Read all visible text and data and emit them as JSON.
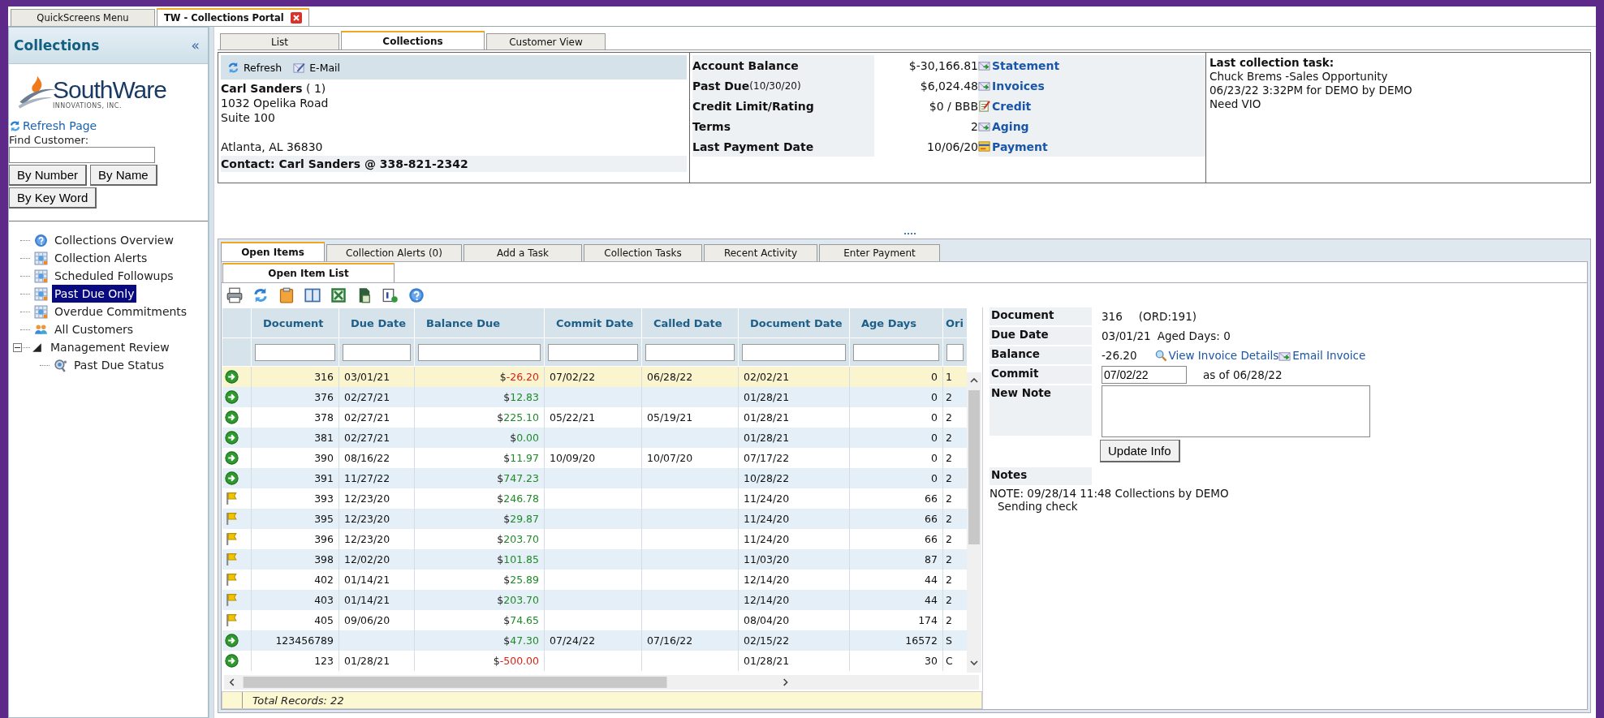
{
  "top_tabs": [
    {
      "label": "QuickScreens Menu",
      "selected": false,
      "closable": false
    },
    {
      "label": "TW - Collections Portal",
      "selected": true,
      "closable": true
    }
  ],
  "sidebar": {
    "title": "Collections",
    "collapse": "«",
    "logo": {
      "name": "SouthWare",
      "tagline": "INNOVATIONS, INC."
    },
    "refresh_link": "Refresh Page",
    "find_label": "Find Customer:",
    "buttons": [
      "By Number",
      "By Name",
      "By Key Word"
    ],
    "tree": [
      {
        "label": "Collections Overview",
        "kind": "help",
        "selected": false
      },
      {
        "label": "Collection Alerts",
        "kind": "report",
        "selected": false
      },
      {
        "label": "Scheduled Followups",
        "kind": "report",
        "selected": false
      },
      {
        "label": "Past Due Only",
        "kind": "report",
        "selected": true
      },
      {
        "label": "Overdue Commitments",
        "kind": "report",
        "selected": false
      },
      {
        "label": "All Customers",
        "kind": "people",
        "selected": false
      },
      {
        "label": "Management Review",
        "kind": "folder",
        "selected": false,
        "expanded": true,
        "children": [
          {
            "label": "Past Due Status",
            "kind": "status",
            "selected": false
          }
        ]
      }
    ]
  },
  "view_tabs": [
    {
      "label": "List",
      "selected": false
    },
    {
      "label": "Collections",
      "selected": true
    },
    {
      "label": "Customer View",
      "selected": false
    }
  ],
  "customer": {
    "toolbar": [
      {
        "label": "Refresh",
        "kind": "refresh"
      },
      {
        "label": "E-Mail",
        "kind": "email"
      }
    ],
    "name": "Carl Sanders",
    "number": "( 1)",
    "address": [
      "1032 Opelika Road",
      "Suite 100"
    ],
    "city_line": "Atlanta, AL  36830",
    "contact_label": "Contact:",
    "contact": "Carl Sanders @ 338-821-2342"
  },
  "account": [
    {
      "label": "Account Balance",
      "value": "$-30,166.81",
      "link": "Statement",
      "kind": "envelope"
    },
    {
      "label": "Past Due",
      "note": "(10/30/20)",
      "value": "$6,024.48",
      "link": "Invoices",
      "kind": "envelope"
    },
    {
      "label": "Credit Limit/Rating",
      "value": "$0 / BBB",
      "link": "Credit",
      "kind": "notepad"
    },
    {
      "label": "Terms",
      "value": "2",
      "link": "Aging",
      "kind": "envelope"
    },
    {
      "label": "Last Payment Date",
      "value": "10/06/20",
      "link": "Payment",
      "kind": "card"
    }
  ],
  "last_task": {
    "title": "Last collection task:",
    "lines": [
      "Chuck Brems -Sales Opportunity",
      "06/23/22 3:32PM for DEMO by DEMO",
      "Need VIO"
    ]
  },
  "detail_tabs": [
    {
      "label": "Open Items",
      "selected": true
    },
    {
      "label": "Collection Alerts (0)",
      "selected": false
    },
    {
      "label": "Add a Task",
      "selected": false
    },
    {
      "label": "Collection Tasks",
      "selected": false
    },
    {
      "label": "Recent Activity",
      "selected": false
    },
    {
      "label": "Enter Payment",
      "selected": false
    }
  ],
  "sub_tabs": [
    {
      "label": "Open Item List",
      "selected": true
    }
  ],
  "table": {
    "columns": [
      "Document",
      "Due Date",
      "Balance Due",
      "Commit Date",
      "Called Date",
      "Document Date",
      "Age Days",
      "Ori"
    ],
    "rows": [
      {
        "kind": "arrow",
        "selected": true,
        "document": "316",
        "due_date": "03/01/21",
        "balance": {
          "currency": "$",
          "amount": "-26.20",
          "negative": true
        },
        "commit_date": "07/02/22",
        "called_date": "06/28/22",
        "document_date": "02/02/21",
        "age_days": "0",
        "column_8": "1"
      },
      {
        "kind": "arrow",
        "selected": false,
        "document": "376",
        "due_date": "02/27/21",
        "balance": {
          "currency": "$",
          "amount": "12.83",
          "negative": false
        },
        "document_date": "01/28/21",
        "age_days": "0",
        "column_8": "2"
      },
      {
        "kind": "arrow",
        "selected": false,
        "document": "378",
        "due_date": "02/27/21",
        "balance": {
          "currency": "$",
          "amount": "225.10",
          "negative": false
        },
        "commit_date": "05/22/21",
        "called_date": "05/19/21",
        "document_date": "01/28/21",
        "age_days": "0",
        "column_8": "2"
      },
      {
        "kind": "arrow",
        "selected": false,
        "document": "381",
        "due_date": "02/27/21",
        "balance": {
          "currency": "$",
          "amount": "0.00",
          "negative": false
        },
        "document_date": "01/28/21",
        "age_days": "0",
        "column_8": "2"
      },
      {
        "kind": "arrow",
        "selected": false,
        "document": "390",
        "due_date": "08/16/22",
        "balance": {
          "currency": "$",
          "amount": "11.97",
          "negative": false
        },
        "commit_date": "10/09/20",
        "called_date": "10/07/20",
        "document_date": "07/17/22",
        "age_days": "0",
        "column_8": "2"
      },
      {
        "kind": "arrow",
        "selected": false,
        "document": "391",
        "due_date": "11/27/22",
        "balance": {
          "currency": "$",
          "amount": "747.23",
          "negative": false
        },
        "document_date": "10/28/22",
        "age_days": "0",
        "column_8": "2"
      },
      {
        "kind": "flag",
        "selected": false,
        "document": "393",
        "due_date": "12/23/20",
        "balance": {
          "currency": "$",
          "amount": "246.78",
          "negative": false
        },
        "document_date": "11/24/20",
        "age_days": "66",
        "column_8": "2"
      },
      {
        "kind": "flag",
        "selected": false,
        "document": "395",
        "due_date": "12/23/20",
        "balance": {
          "currency": "$",
          "amount": "29.87",
          "negative": false
        },
        "document_date": "11/24/20",
        "age_days": "66",
        "column_8": "2"
      },
      {
        "kind": "flag",
        "selected": false,
        "document": "396",
        "due_date": "12/23/20",
        "balance": {
          "currency": "$",
          "amount": "203.70",
          "negative": false
        },
        "document_date": "11/24/20",
        "age_days": "66",
        "column_8": "2"
      },
      {
        "kind": "flag",
        "selected": false,
        "document": "398",
        "due_date": "12/02/20",
        "balance": {
          "currency": "$",
          "amount": "101.85",
          "negative": false
        },
        "document_date": "11/03/20",
        "age_days": "87",
        "column_8": "2"
      },
      {
        "kind": "flag",
        "selected": false,
        "document": "402",
        "due_date": "01/14/21",
        "balance": {
          "currency": "$",
          "amount": "25.89",
          "negative": false
        },
        "document_date": "12/14/20",
        "age_days": "44",
        "column_8": "2"
      },
      {
        "kind": "flag",
        "selected": false,
        "document": "403",
        "due_date": "01/14/21",
        "balance": {
          "currency": "$",
          "amount": "203.70",
          "negative": false
        },
        "document_date": "12/14/20",
        "age_days": "44",
        "column_8": "2"
      },
      {
        "kind": "flag",
        "selected": false,
        "document": "405",
        "due_date": "09/06/20",
        "balance": {
          "currency": "$",
          "amount": "74.65",
          "negative": false
        },
        "document_date": "08/04/20",
        "age_days": "174",
        "column_8": "2"
      },
      {
        "kind": "arrow",
        "selected": false,
        "document": "123456789",
        "balance": {
          "currency": "$",
          "amount": "47.30",
          "negative": false
        },
        "commit_date": "07/24/22",
        "called_date": "07/16/22",
        "document_date": "02/15/22",
        "age_days": "16572",
        "column_8": "S"
      },
      {
        "kind": "arrow",
        "selected": false,
        "document": "123",
        "due_date": "01/28/21",
        "balance": {
          "currency": "$",
          "amount": "-500.00",
          "negative": true
        },
        "document_date": "01/28/21",
        "age_days": "30",
        "column_8": "C"
      }
    ],
    "footer": "Total Records: 22"
  },
  "detail": {
    "document_label": "Document",
    "document": "316",
    "order": "(ORD:191)",
    "due_label": "Due Date",
    "due_date": "03/01/21",
    "aged": "Aged Days: 0",
    "balance_label": "Balance",
    "balance": "-26.20",
    "links": [
      {
        "label": "View Invoice Details",
        "kind": "magnifier"
      },
      {
        "label": "Email Invoice",
        "kind": "envelope"
      }
    ],
    "commit_label": "Commit",
    "commit": "07/02/22",
    "as_of": "as of  06/28/22",
    "note_label": "New Note",
    "button": "Update Info",
    "notes_label": "Notes",
    "notes": [
      "NOTE: 09/28/14 11:48 Collections by DEMO",
      "Sending check"
    ]
  }
}
